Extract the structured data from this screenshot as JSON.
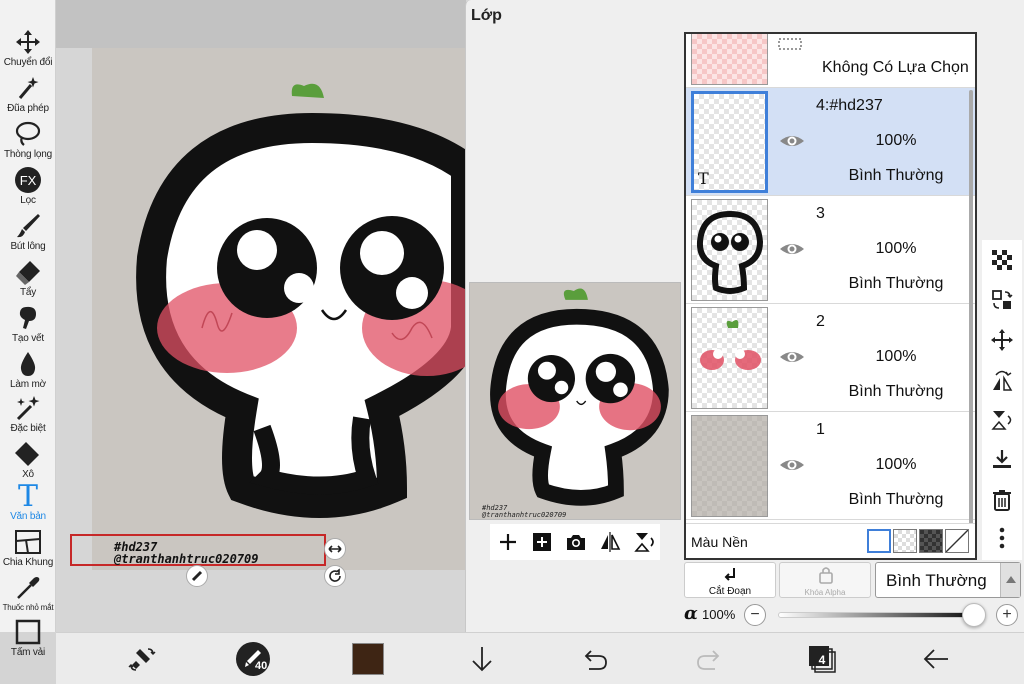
{
  "toolbar": {
    "tools": [
      {
        "name": "Chuyển đổi",
        "icon": "move-icon"
      },
      {
        "name": "Đũa phép",
        "icon": "magic-wand-icon"
      },
      {
        "name": "Thòng lọng",
        "icon": "lasso-icon"
      },
      {
        "name": "Lọc",
        "icon": "fx-icon",
        "fx": "FX"
      },
      {
        "name": "Bút lông",
        "icon": "brush-icon"
      },
      {
        "name": "Tẩy",
        "icon": "eraser-icon"
      },
      {
        "name": "Tạo vết",
        "icon": "smudge-icon"
      },
      {
        "name": "Làm mờ",
        "icon": "blur-icon"
      },
      {
        "name": "Đặc biệt",
        "icon": "special-icon"
      },
      {
        "name": "Xô",
        "icon": "bucket-icon"
      },
      {
        "name": "Văn bản",
        "icon": "text-icon",
        "glyph": "T",
        "active": true
      },
      {
        "name": "Chia Khung",
        "icon": "frame-divider-icon"
      },
      {
        "name": "Thuốc nhỏ mắt",
        "icon": "eyedropper-icon"
      },
      {
        "name": "Tấm vải",
        "icon": "canvas-icon"
      }
    ]
  },
  "canvas": {
    "text_lines": [
      "#hd237",
      "@tranthanhtruc020709"
    ]
  },
  "layer_panel": {
    "title": "Lớp",
    "selection_label": "Không Có Lựa Chọn",
    "preview_caption": [
      "#hd237",
      "@tranthanhtruc020709"
    ],
    "preview_tools": [
      "add-layer-icon",
      "add-layer-copy-icon",
      "camera-icon",
      "flip-horizontal-icon",
      "flip-vertical-icon"
    ],
    "layers": [
      {
        "name": "4:#hd237",
        "opacity": "100%",
        "blend": "Bình Thường",
        "selected": true,
        "thumb_text": "T",
        "thumb": "text"
      },
      {
        "name": "3",
        "opacity": "100%",
        "blend": "Bình Thường",
        "selected": false,
        "thumb": "lineart"
      },
      {
        "name": "2",
        "opacity": "100%",
        "blend": "Bình Thường",
        "selected": false,
        "thumb": "color"
      },
      {
        "name": "1",
        "opacity": "100%",
        "blend": "Bình Thường",
        "selected": false,
        "thumb": "background"
      }
    ],
    "background_label": "Màu Nền",
    "clip_label": "Cắt Đoạn",
    "alpha_lock_label": "Khóa Alpha",
    "blend_mode": "Bình Thường",
    "alpha_symbol": "α",
    "alpha_value": "100%",
    "alpha_fraction": 1.0,
    "minus": "−",
    "plus": "+"
  },
  "bottom_bar": {
    "brush_size": "40",
    "color": "#3e2514",
    "layer_count": "4"
  },
  "colors": {
    "accent": "#1e88e5",
    "selected_layer": "#d3e0f5",
    "text_box_border": "#c62828",
    "cheek": "#e05064",
    "leaf": "#5a9e3c"
  }
}
